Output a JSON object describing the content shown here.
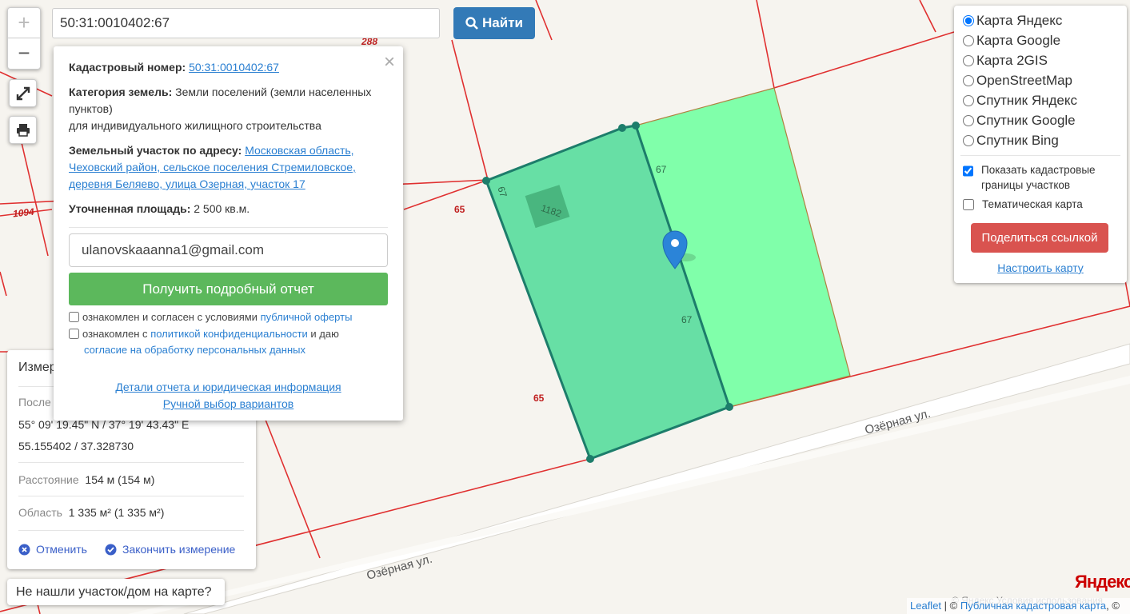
{
  "search": {
    "value": "50:31:0010402:67",
    "button_label": "Найти"
  },
  "zoom": {
    "in_label": "+",
    "out_label": "−"
  },
  "popup": {
    "close_label": "×",
    "cadastral_label": "Кадастровый номер:",
    "cadastral_value": "50:31:0010402:67",
    "category_label": "Категория земель:",
    "category_value": "Земли поселений (земли населенных пунктов)",
    "category_use": "для индивидуального жилищного строительства",
    "address_label": "Земельный участок по адресу:",
    "address_value": "Московская область, Чеховский район, сельское поселения Стремиловское, деревня Беляево, улица Озерная, участок 17",
    "area_label": "Уточненная площадь:",
    "area_value": "2 500 кв.м.",
    "email_value": "ulanovskaaanna1@gmail.com",
    "report_button": "Получить подробный отчет",
    "agree1_text": "ознакомлен и согласен с условиями",
    "agree1_link": "публичной оферты",
    "agree2_text": "ознакомлен с",
    "agree2_link": "политикой конфиденциальности",
    "agree2_text2": "и даю",
    "agree2_link2": "согласие на обработку персональных данных",
    "details_link": "Детали отчета и юридическая информация",
    "manual_link": "Ручной выбор вариантов"
  },
  "layers": {
    "base": [
      "Карта Яндекс",
      "Карта Google",
      "Карта 2GIS",
      "OpenStreetMap",
      "Спутник Яндекс",
      "Спутник Google",
      "Спутник Bing"
    ],
    "selected_index": 0,
    "show_cadastral": "Показать кадастровые границы участков",
    "show_cadastral_checked": true,
    "thematic": "Тематическая карта",
    "thematic_checked": false,
    "share_button": "Поделиться ссылкой",
    "configure_link": "Настроить карту"
  },
  "measure": {
    "title": "Измер",
    "last_label": "После",
    "coords_dms": "55° 09' 19.45\" N / 37° 19' 43.43\" E",
    "coords_dec": "55.155402 / 37.328730",
    "distance_label": "Расстояние",
    "distance_value": "154 м (154 м)",
    "area_label": "Область",
    "area_value": "1 335 м² (1 335 м²)",
    "cancel_label": "Отменить",
    "finish_label": "Закончить измерение"
  },
  "not_found": "Не нашли участок/дом на карте?",
  "map_labels": {
    "parcel_number": "1182",
    "edge_67_a": "67",
    "edge_67_b": "67",
    "edge_67_c": "67",
    "edge_65_a": "65",
    "edge_65_b": "65",
    "parcel_1094": "1094",
    "parcel_288": "288",
    "street_upper": "Озёрная ул.",
    "street_lower": "Озёрная ул."
  },
  "attribution": {
    "leaflet": "Leaflet",
    "sep": "| ©",
    "pkk": "Публичная кадастровая карта",
    "tail": ", ©"
  },
  "yandex": {
    "logo": "Яндекс",
    "terms": "© Яндекс  Условия использования"
  },
  "colors": {
    "primary": "#337ab7",
    "success": "#5cb85c",
    "danger": "#d9534f",
    "parcel_fill": "#80ffaa",
    "selected_fill": "#5fdda0",
    "boundary": "#e03030"
  }
}
